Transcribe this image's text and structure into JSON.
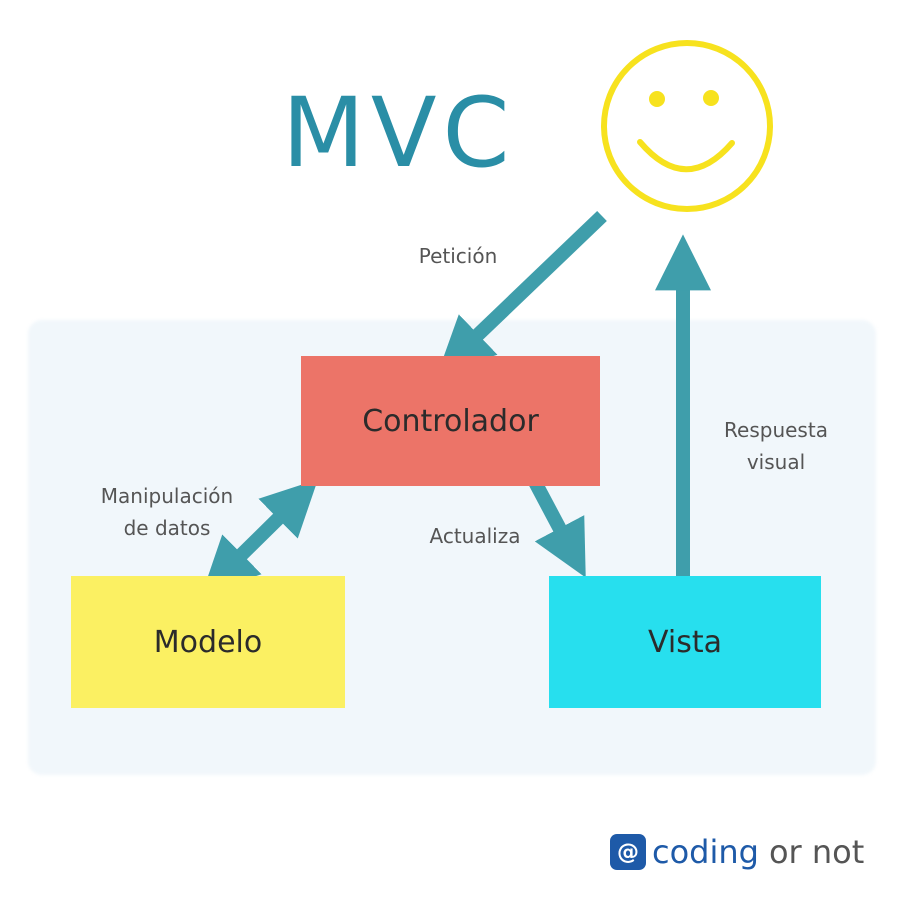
{
  "title": "MVC",
  "user": {
    "icon": "smiley-face-icon",
    "color": "#f7e21e"
  },
  "nodes": {
    "controlador": {
      "label": "Controlador",
      "color": "#ec7468"
    },
    "modelo": {
      "label": "Modelo",
      "color": "#fbf062"
    },
    "vista": {
      "label": "Vista",
      "color": "#27dfee"
    }
  },
  "edges": {
    "peticion": {
      "label": "Petición"
    },
    "manipulacion": {
      "label": "Manipulación\nde datos"
    },
    "actualiza": {
      "label": "Actualiza"
    },
    "respuesta": {
      "label": "Respuesta\nvisual"
    }
  },
  "arrow_color": "#3f9eab",
  "logo": {
    "icon": "coding-or-not-logo-icon",
    "word_a": "coding",
    "word_b": "or not",
    "color": "#1e5aa8"
  }
}
